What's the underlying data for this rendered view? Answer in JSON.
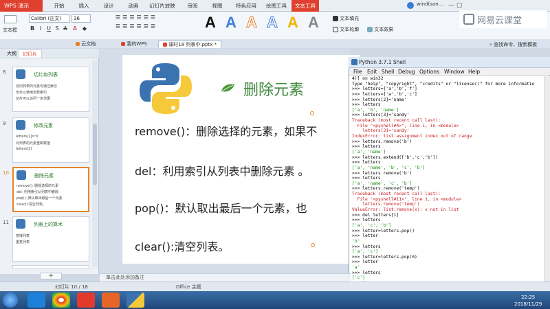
{
  "app": {
    "name": "WPS 演示",
    "menu_tabs": [
      "开始",
      "插入",
      "设计",
      "动画",
      "幻灯片放映",
      "审阅",
      "视图",
      "特色应用",
      "绘图工具",
      "文本工具"
    ],
    "user": "wind(san...",
    "netease": "网易云课堂"
  },
  "ribbon": {
    "text_box_label": "文本框",
    "font_name": "Calibri (正文)",
    "font_size": "36",
    "text_fill": "文本填充",
    "text_outline": "文本轮廓",
    "text_effect": "文本效果",
    "find_label": "查找命令、搜索模板"
  },
  "doc_tabs": [
    "云文档",
    "我的WPS",
    "课时18 列表中.pptx *"
  ],
  "left_pane": {
    "tabs": [
      "大纲",
      "幻灯片"
    ],
    "slides": [
      {
        "num": "8",
        "title": "切片和列表",
        "lines": [
          "访问列表的元素可通过索引",
          "也可以使用负数索引",
          "切片可以访问一定范围"
        ]
      },
      {
        "num": "9",
        "title": "修改元素",
        "lines": [
          "letters[1]='b'",
          "对列表的元素重新赋值",
          "letters[2]"
        ]
      },
      {
        "num": "10",
        "title": "删除元素",
        "lines": [
          "remove(): 删除选择的元素",
          "del: 利用索引从列表中删除",
          "pop(): 默认取出最后一个元素",
          "clear():清空列表。"
        ]
      },
      {
        "num": "11",
        "title": "列表上的算术",
        "lines": [
          "拼接列表",
          "重复列表"
        ]
      }
    ],
    "add_slide": "+"
  },
  "slide": {
    "heading": "删除元素",
    "bullets": [
      "remove()：删除选择的元素，如果不",
      "del：利用索引从列表中删除元素  。",
      "pop()：默认取出最后一个元素，也",
      "clear():清空列表。"
    ]
  },
  "shell": {
    "title": "Python 3.7.1 Shell",
    "menu": [
      "File",
      "Edit",
      "Shell",
      "Debug",
      "Options",
      "Window",
      "Help"
    ],
    "lines": [
      {
        "t": "4)] on win32",
        "c": ""
      },
      {
        "t": "Type \"help\", \"copyright\", \"credits\" or \"license()\" for more informatio",
        "c": ""
      },
      {
        "t": ">>> letters=['a','b','f']",
        "c": ""
      },
      {
        "t": ">>> letters=['a','b','c']",
        "c": ""
      },
      {
        "t": ">>> letters[2]='name'",
        "c": ""
      },
      {
        "t": ">>> letters",
        "c": ""
      },
      {
        "t": "['a', 'b', 'name']",
        "c": "str"
      },
      {
        "t": ">>> letters[3]='sandy'",
        "c": ""
      },
      {
        "t": "Traceback (most recent call last):",
        "c": "err"
      },
      {
        "t": "  File \"<pyshell#4>\", line 1, in <module>",
        "c": "err"
      },
      {
        "t": "    letters[3]='sandy'",
        "c": "err"
      },
      {
        "t": "IndexError: list assignment index out of range",
        "c": "err"
      },
      {
        "t": ">>> letters.remove('b')",
        "c": ""
      },
      {
        "t": ">>> letters",
        "c": ""
      },
      {
        "t": "['a', 'name']",
        "c": "str"
      },
      {
        "t": ">>> letters.extend(['b','c','b'])",
        "c": ""
      },
      {
        "t": ">>> letters",
        "c": ""
      },
      {
        "t": "['a', 'name', 'b', 'c', 'b']",
        "c": "str"
      },
      {
        "t": ">>> letters.remove('b')",
        "c": ""
      },
      {
        "t": ">>> letters",
        "c": ""
      },
      {
        "t": "['a', 'name', 'c', 'b']",
        "c": "str"
      },
      {
        "t": ">>> letters.remove('temp')",
        "c": ""
      },
      {
        "t": "Traceback (most recent call last):",
        "c": "err"
      },
      {
        "t": "  File \"<pyshell#11>\", line 1, in <module>",
        "c": "err"
      },
      {
        "t": "    letters.remove('temp')",
        "c": "err"
      },
      {
        "t": "ValueError: list.remove(x): x not in list",
        "c": "err"
      },
      {
        "t": ">>> del letters[1]",
        "c": ""
      },
      {
        "t": ">>> letters",
        "c": ""
      },
      {
        "t": "['a', 'c', 'b']",
        "c": "str"
      },
      {
        "t": ">>> letter=letters.pop()",
        "c": ""
      },
      {
        "t": ">>> letter",
        "c": ""
      },
      {
        "t": "'b'",
        "c": "str"
      },
      {
        "t": ">>> letters",
        "c": ""
      },
      {
        "t": "['a', 'c']",
        "c": "str"
      },
      {
        "t": ">>> letter=letters.pop(0)",
        "c": ""
      },
      {
        "t": ">>> letter",
        "c": ""
      },
      {
        "t": "'a'",
        "c": "str"
      },
      {
        "t": ">>> letters",
        "c": ""
      },
      {
        "t": "['c']",
        "c": "str"
      },
      {
        "t": ">>> |",
        "c": ""
      }
    ]
  },
  "notes_placeholder": "单击此处添加备注",
  "status": {
    "slide_counter": "幻灯片 10 / 18",
    "theme": "Office 主题"
  },
  "clock": {
    "time": "22:25",
    "date": "2018/11/29"
  },
  "colors": {
    "wps_red": "#e0402f",
    "heading_green": "#3f8a3f",
    "selection_orange": "#e8832a",
    "error_red": "#c8191e",
    "string_green": "#0a8a0a"
  }
}
